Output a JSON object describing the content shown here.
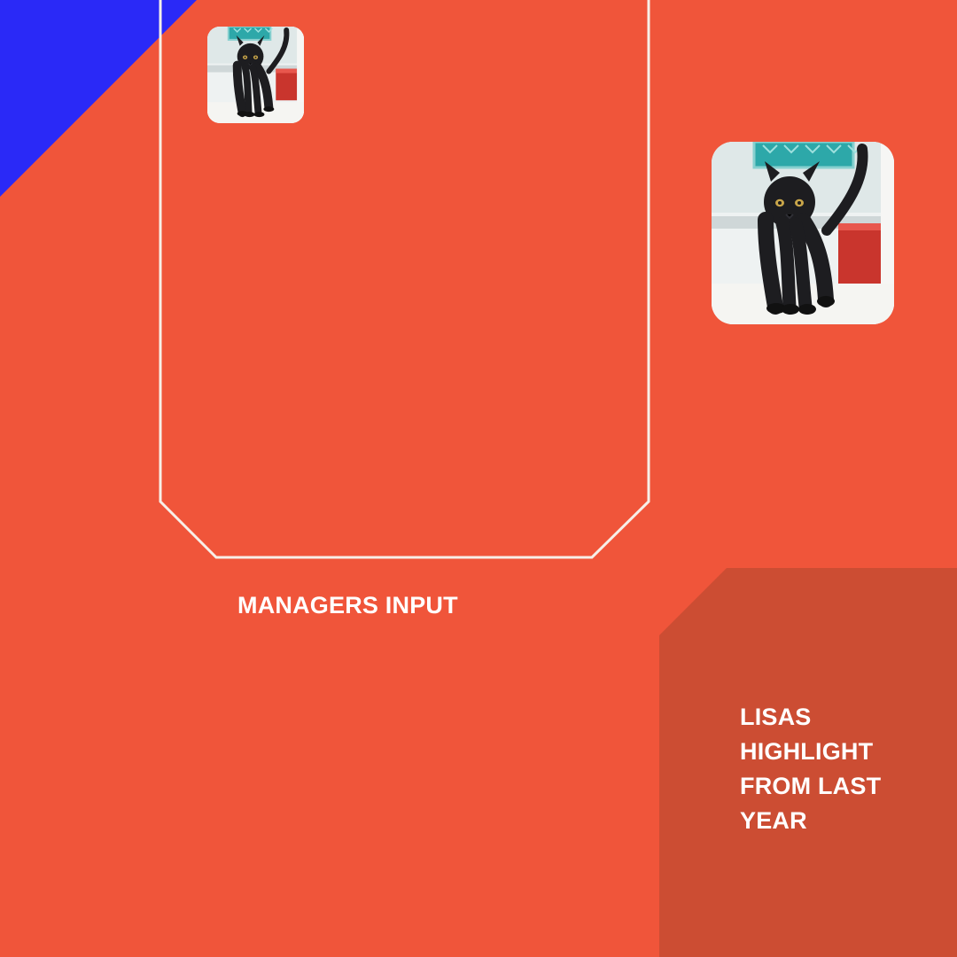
{
  "page": {
    "background_color": "#f0553a"
  },
  "decorations": {
    "corner_triangle_color": "#2a29f7",
    "frame_stroke_color": "#f7efe8",
    "highlight_panel_color": "#cc4d33"
  },
  "images": {
    "small_cat_photo": {
      "icon": "black-kitten-photo"
    },
    "large_cat_photo": {
      "icon": "black-kitten-photo"
    }
  },
  "content": {
    "managers_input_label": "MANAGERS INPUT",
    "highlight_label": "LISAS HIGHLIGHT FROM LAST YEAR"
  }
}
